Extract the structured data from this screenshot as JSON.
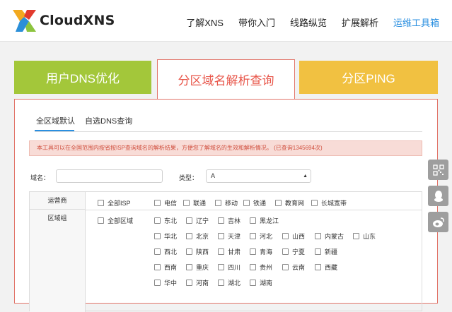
{
  "header": {
    "logo_text": "CloudXNS",
    "nav": [
      "了解XNS",
      "带你入门",
      "线路纵览",
      "扩展解析",
      "运维工具箱"
    ]
  },
  "big_tabs": [
    "用户DNS优化",
    "分区域名解析查询",
    "分区PING"
  ],
  "sub_tabs": [
    "全区域默认",
    "自选DNS查询"
  ],
  "notice": {
    "text": "本工具可以在全国范围内按省按ISP查询域名的解析结果，方便您了解域名的生效和解析情况。",
    "count_prefix": "(已查询",
    "count": "1345694",
    "count_suffix": "次)"
  },
  "form": {
    "domain_label": "域名：",
    "type_label": "类型：",
    "type_value": "A"
  },
  "isp": {
    "label": "运营商",
    "all": "全部ISP",
    "options": [
      "电信",
      "联通",
      "移动",
      "铁通",
      "教育网",
      "长城宽带"
    ]
  },
  "region": {
    "label": "区域组",
    "all": "全部区域",
    "groups": [
      {
        "name": "东北",
        "items": [
          "辽宁",
          "吉林",
          "黑龙江"
        ]
      },
      {
        "name": "华北",
        "items": [
          "北京",
          "天津",
          "河北",
          "山西",
          "内蒙古",
          "山东"
        ]
      },
      {
        "name": "西北",
        "items": [
          "陕西",
          "甘肃",
          "青海",
          "宁夏",
          "新疆"
        ]
      },
      {
        "name": "西南",
        "items": [
          "重庆",
          "四川",
          "贵州",
          "云南",
          "西藏"
        ]
      },
      {
        "name": "华中",
        "items": [
          "河南",
          "湖北",
          "湖南"
        ]
      }
    ]
  }
}
